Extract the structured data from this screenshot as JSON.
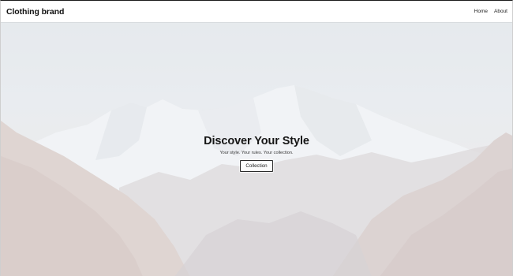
{
  "navbar": {
    "brand": "Clothing brand",
    "links": [
      {
        "label": "Home"
      },
      {
        "label": "About"
      }
    ]
  },
  "hero": {
    "title": "Discover Your Style",
    "subtitle": "Your style. Your rules. Your collection.",
    "cta_label": "Collection",
    "background": "mountain-landscape-image"
  },
  "colors": {
    "navbar_bg": "#ffffff",
    "text": "#161616",
    "overlay": "#e6eaee"
  }
}
